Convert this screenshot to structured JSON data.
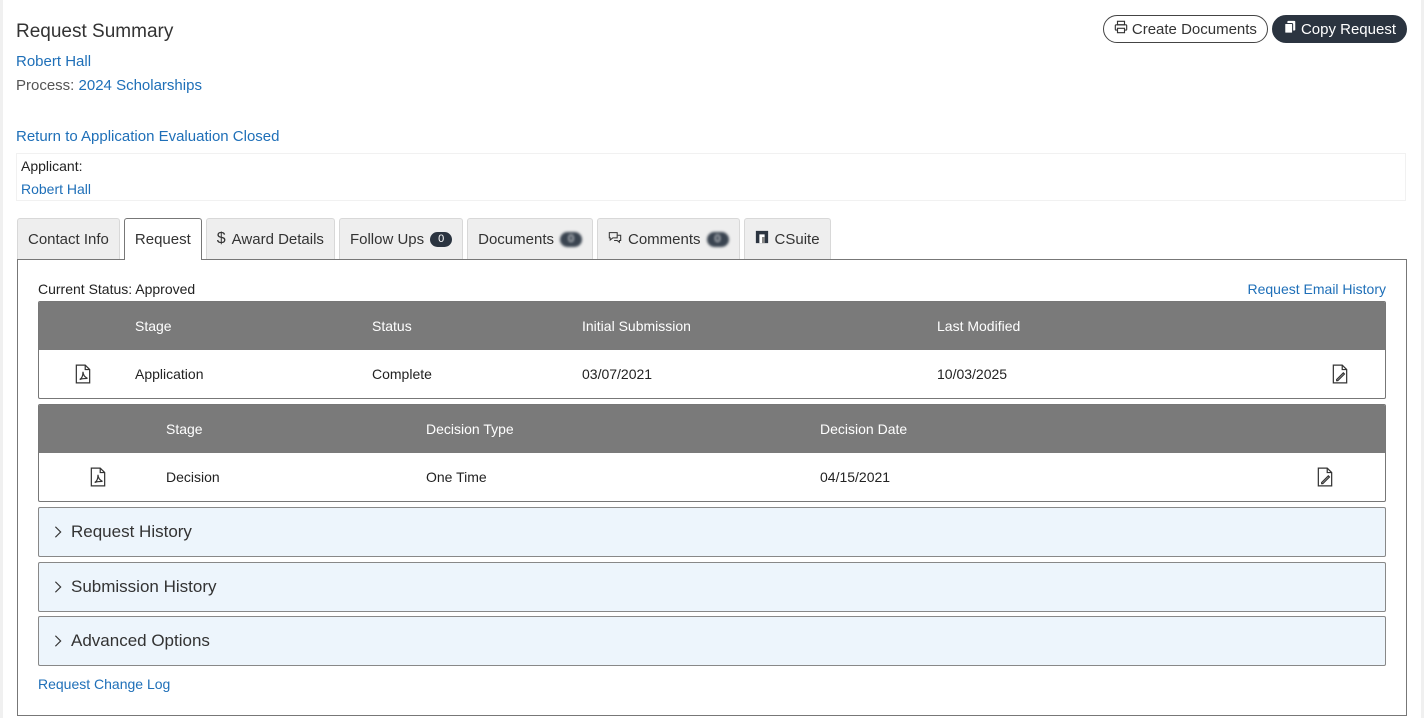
{
  "header": {
    "title": "Request Summary",
    "applicant_link": "Robert Hall",
    "process_label": "Process:",
    "process_link": "2024 Scholarships",
    "return_link": "Return to Application Evaluation Closed"
  },
  "buttons": {
    "create_documents": "Create Documents",
    "copy_request": "Copy Request"
  },
  "applicant": {
    "label": "Applicant:",
    "name": "Robert Hall"
  },
  "tabs": [
    {
      "label": "Contact Info"
    },
    {
      "label": "Request"
    },
    {
      "label": "Award Details",
      "icon": "dollar-icon"
    },
    {
      "label": "Follow Ups",
      "badge": "0"
    },
    {
      "label": "Documents",
      "badge": "0"
    },
    {
      "label": "Comments",
      "icon": "comments-icon",
      "badge": "0"
    },
    {
      "label": "CSuite",
      "icon": "csuite-icon"
    }
  ],
  "panel": {
    "current_status": "Current Status: Approved",
    "email_history": "Request Email History",
    "stage_table": {
      "headers": [
        "Stage",
        "Status",
        "Initial Submission",
        "Last Modified"
      ],
      "rows": [
        {
          "stage": "Application",
          "status": "Complete",
          "initial": "03/07/2021",
          "modified": "10/03/2025"
        }
      ]
    },
    "decision_table": {
      "headers": [
        "Stage",
        "Decision Type",
        "Decision Date"
      ],
      "rows": [
        {
          "stage": "Decision",
          "type": "One Time",
          "date": "04/15/2021"
        }
      ]
    },
    "accordions": [
      "Request History",
      "Submission History",
      "Advanced Options"
    ],
    "change_log": "Request Change Log"
  },
  "colors": {
    "link": "#1e6fb8",
    "dark_button": "#2b3440",
    "table_header": "#7a7a7a",
    "accordion_bg": "#edf5fc"
  }
}
